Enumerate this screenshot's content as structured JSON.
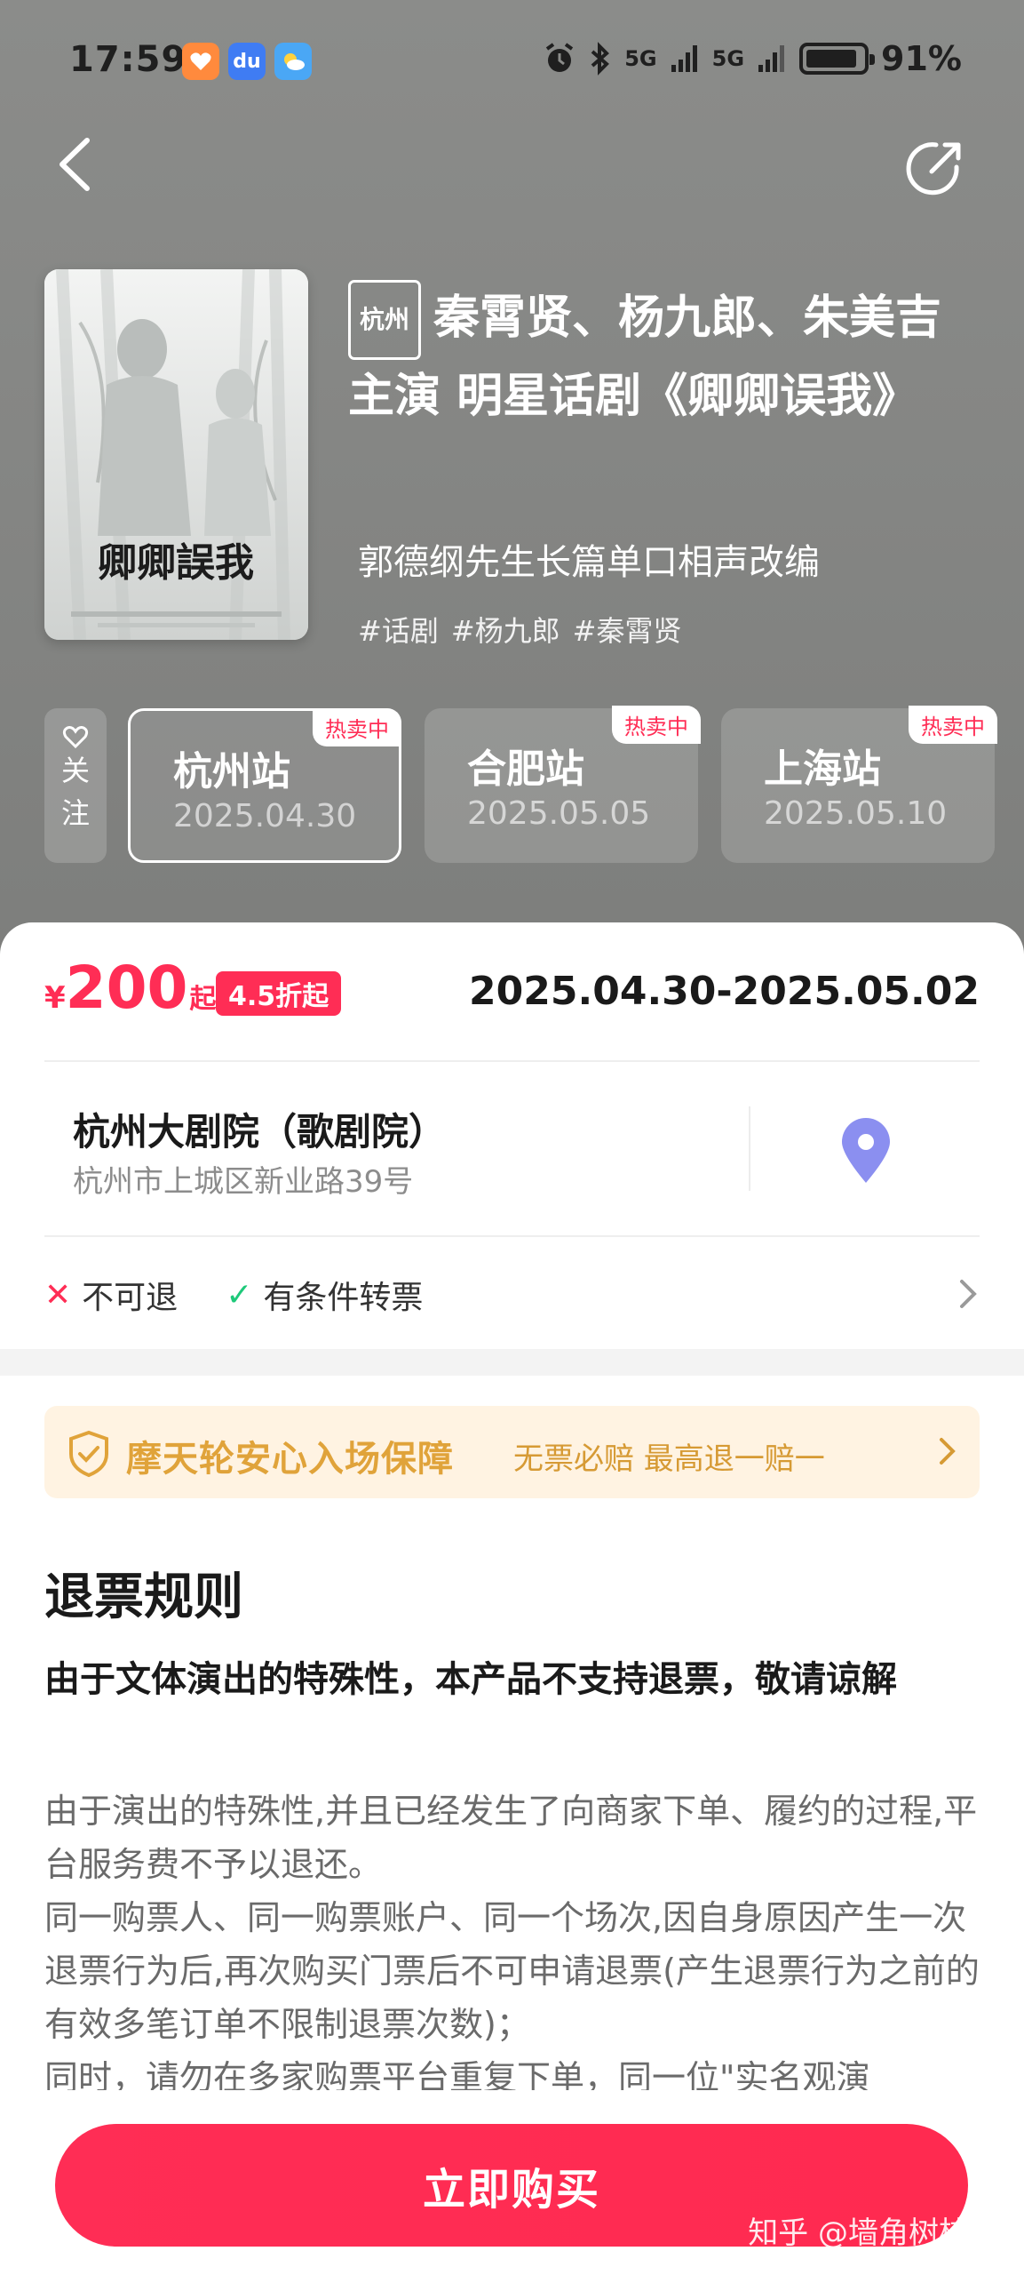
{
  "status_bar": {
    "time": "17:59",
    "battery_text": "91%",
    "battery_level": 0.91,
    "signal_1": "5G",
    "signal_2": "5G",
    "apps": [
      {
        "icon": "heart-app-icon",
        "color": "#ff8a3d"
      },
      {
        "icon": "baidu-app-icon",
        "label": "du",
        "color": "#3f7cf3"
      },
      {
        "icon": "weather-app-icon",
        "color": "#4aa7f5"
      }
    ]
  },
  "show": {
    "city_tag": "杭州",
    "title": "秦霄贤、杨九郎、朱美吉主演 明星话剧《卿卿误我》",
    "subtitle": "郭德纲先生长篇单口相声改编",
    "tags": [
      "#话剧",
      "#杨九郎",
      "#秦霄贤"
    ],
    "poster_title": "卿卿誤我"
  },
  "follow": {
    "label_1": "关",
    "label_2": "注"
  },
  "stations": [
    {
      "name": "杭州站",
      "date": "2025.04.30",
      "badge": "热卖中",
      "active": true
    },
    {
      "name": "合肥站",
      "date": "2025.05.05",
      "badge": "热卖中",
      "active": false
    },
    {
      "name": "上海站",
      "date": "2025.05.10",
      "badge": "热卖中",
      "active": false
    }
  ],
  "pricing": {
    "currency": "¥",
    "price": "200",
    "suffix": "起",
    "discount": "4.5折起",
    "date_range": "2025.04.30-2025.05.02"
  },
  "venue": {
    "name": "杭州大剧院（歌剧院）",
    "address": "杭州市上城区新业路39号"
  },
  "policy": {
    "refund": "不可退",
    "transfer": "有条件转票"
  },
  "guarantee": {
    "title": "摩天轮安心入场保障",
    "subtitle": "无票必赔 最高退一赔一"
  },
  "rules": {
    "title": "退票规则",
    "subtitle": "由于文体演出的特殊性，本产品不支持退票，敬请谅解",
    "paragraphs": [
      "由于演出的特殊性,并且已经发生了向商家下单、履约的过程,平台服务费不予以退还。",
      "同一购票人、同一购票账户、同一个场次,因自身原因产生一次退票行为后,再次购买门票后不可申请退票(产生退票行为之前的有效多笔订单不限制退票次数)；",
      "同时，请勿在多家购票平台重复下单，同一位\"实名观演"
    ]
  },
  "buy": {
    "label": "立即购买"
  },
  "watermark": "知乎 @墙角树枝霉",
  "colors": {
    "accent": "#ff2d55",
    "hero_bg": "#858684",
    "guarantee_bg": "#fff3e2",
    "guarantee_text": "#e0a33a",
    "success": "#1ec97a"
  }
}
